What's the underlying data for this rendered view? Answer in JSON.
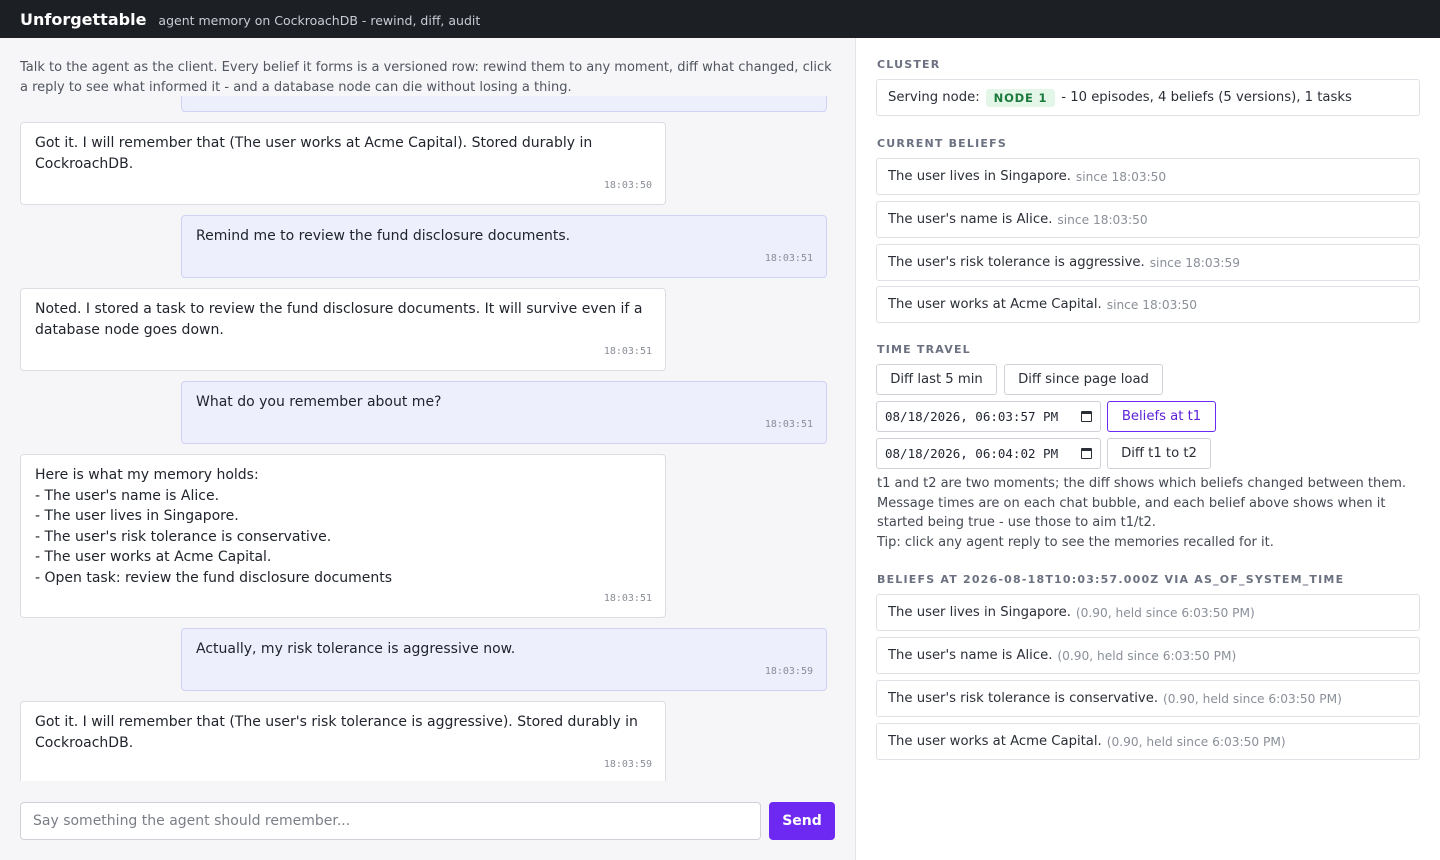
{
  "header": {
    "title": "Unforgettable",
    "tagline": "agent memory on CockroachDB - rewind, diff, audit"
  },
  "chat": {
    "intro": "Talk to the agent as the client. Every belief it forms is a versioned row: rewind them to any moment, diff what changed, click a reply to see what informed it - and a database node can die without losing a thing.",
    "messages": [
      {
        "role": "user",
        "text": "",
        "time": ""
      },
      {
        "role": "agent",
        "text": "Got it. I will remember that (The user works at Acme Capital). Stored durably in CockroachDB.",
        "time": "18:03:50"
      },
      {
        "role": "user",
        "text": "Remind me to review the fund disclosure documents.",
        "time": "18:03:51"
      },
      {
        "role": "agent",
        "text": "Noted. I stored a task to review the fund disclosure documents. It will survive even if a database node goes down.",
        "time": "18:03:51"
      },
      {
        "role": "user",
        "text": "What do you remember about me?",
        "time": "18:03:51"
      },
      {
        "role": "agent",
        "text": "Here is what my memory holds:\n- The user's name is Alice.\n- The user lives in Singapore.\n- The user's risk tolerance is conservative.\n- The user works at Acme Capital.\n- Open task: review the fund disclosure documents",
        "time": "18:03:51"
      },
      {
        "role": "user",
        "text": "Actually, my risk tolerance is aggressive now.",
        "time": "18:03:59"
      },
      {
        "role": "agent",
        "text": "Got it. I will remember that (The user's risk tolerance is aggressive). Stored durably in CockroachDB.",
        "time": "18:03:59"
      }
    ],
    "input_placeholder": "Say something the agent should remember...",
    "send_label": "Send"
  },
  "cluster": {
    "heading": "CLUSTER",
    "serving_label": "Serving node:",
    "node": "NODE 1",
    "summary": "- 10 episodes, 4 beliefs (5 versions), 1 tasks"
  },
  "current_beliefs": {
    "heading": "CURRENT BELIEFS",
    "items": [
      {
        "text": "The user lives in Singapore.",
        "meta": "since 18:03:50"
      },
      {
        "text": "The user's name is Alice.",
        "meta": "since 18:03:50"
      },
      {
        "text": "The user's risk tolerance is aggressive.",
        "meta": "since 18:03:59"
      },
      {
        "text": "The user works at Acme Capital.",
        "meta": "since 18:03:50"
      }
    ]
  },
  "time_travel": {
    "heading": "TIME TRAVEL",
    "diff_last_label": "Diff last 5 min",
    "diff_page_label": "Diff since page load",
    "t1_value": "08/18/2026, 06:03:57 PM",
    "t2_value": "08/18/2026, 06:04:02 PM",
    "beliefs_at_label": "Beliefs at t1",
    "diff_t1_t2_label": "Diff t1 to t2",
    "help_lines": [
      "t1 and t2 are two moments; the diff shows which beliefs changed between them.",
      "Message times are on each chat bubble, and each belief above shows when it started being true - use those to aim t1/t2.",
      "Tip: click any agent reply to see the memories recalled for it."
    ]
  },
  "as_of": {
    "heading": "BELIEFS AT 2026-08-18T10:03:57.000Z VIA AS_OF_SYSTEM_TIME",
    "items": [
      {
        "text": "The user lives in Singapore.",
        "meta": "(0.90, held since 6:03:50 PM)"
      },
      {
        "text": "The user's name is Alice.",
        "meta": "(0.90, held since 6:03:50 PM)"
      },
      {
        "text": "The user's risk tolerance is conservative.",
        "meta": "(0.90, held since 6:03:50 PM)"
      },
      {
        "text": "The user works at Acme Capital.",
        "meta": "(0.90, held since 6:03:50 PM)"
      }
    ]
  }
}
